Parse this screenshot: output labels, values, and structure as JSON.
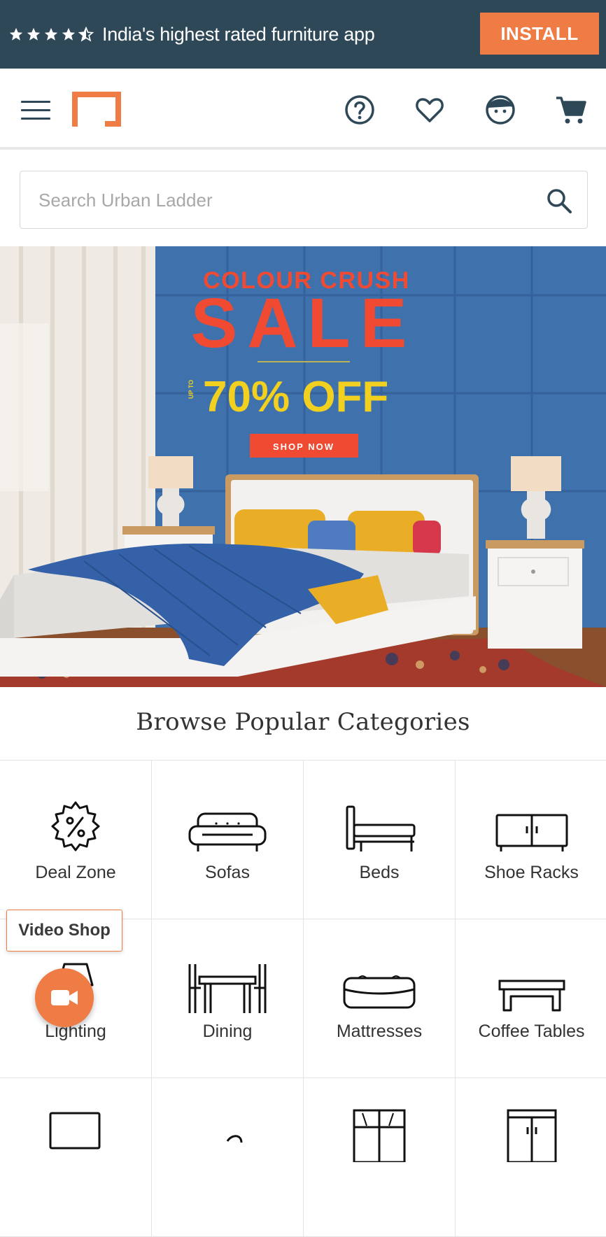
{
  "install_bar": {
    "rating_stars": 4.5,
    "promo_text": "India's highest rated furniture app",
    "install_label": "INSTALL"
  },
  "header": {
    "icons": [
      "menu-icon",
      "logo",
      "help-icon",
      "heart-icon",
      "profile-icon",
      "cart-icon"
    ]
  },
  "search": {
    "placeholder": "Search Urban Ladder"
  },
  "hero": {
    "headline_small": "COLOUR CRUSH",
    "headline_big": "SALE",
    "upto": "UP TO",
    "offer": "70% OFF",
    "cta": "SHOP NOW"
  },
  "categories": {
    "title": "Browse Popular Categories",
    "items": [
      {
        "label": "Deal Zone",
        "icon": "deal-zone-icon"
      },
      {
        "label": "Sofas",
        "icon": "sofa-icon"
      },
      {
        "label": "Beds",
        "icon": "bed-icon"
      },
      {
        "label": "Shoe Racks",
        "icon": "shoe-rack-icon"
      },
      {
        "label": "Lighting",
        "icon": "lamp-icon"
      },
      {
        "label": "Dining",
        "icon": "dining-icon"
      },
      {
        "label": "Mattresses",
        "icon": "mattress-icon"
      },
      {
        "label": "Coffee Tables",
        "icon": "coffee-table-icon"
      }
    ]
  },
  "video_shop": {
    "label": "Video Shop"
  },
  "colors": {
    "brand_dark": "#2f4858",
    "accent_orange": "#ef7b45"
  }
}
